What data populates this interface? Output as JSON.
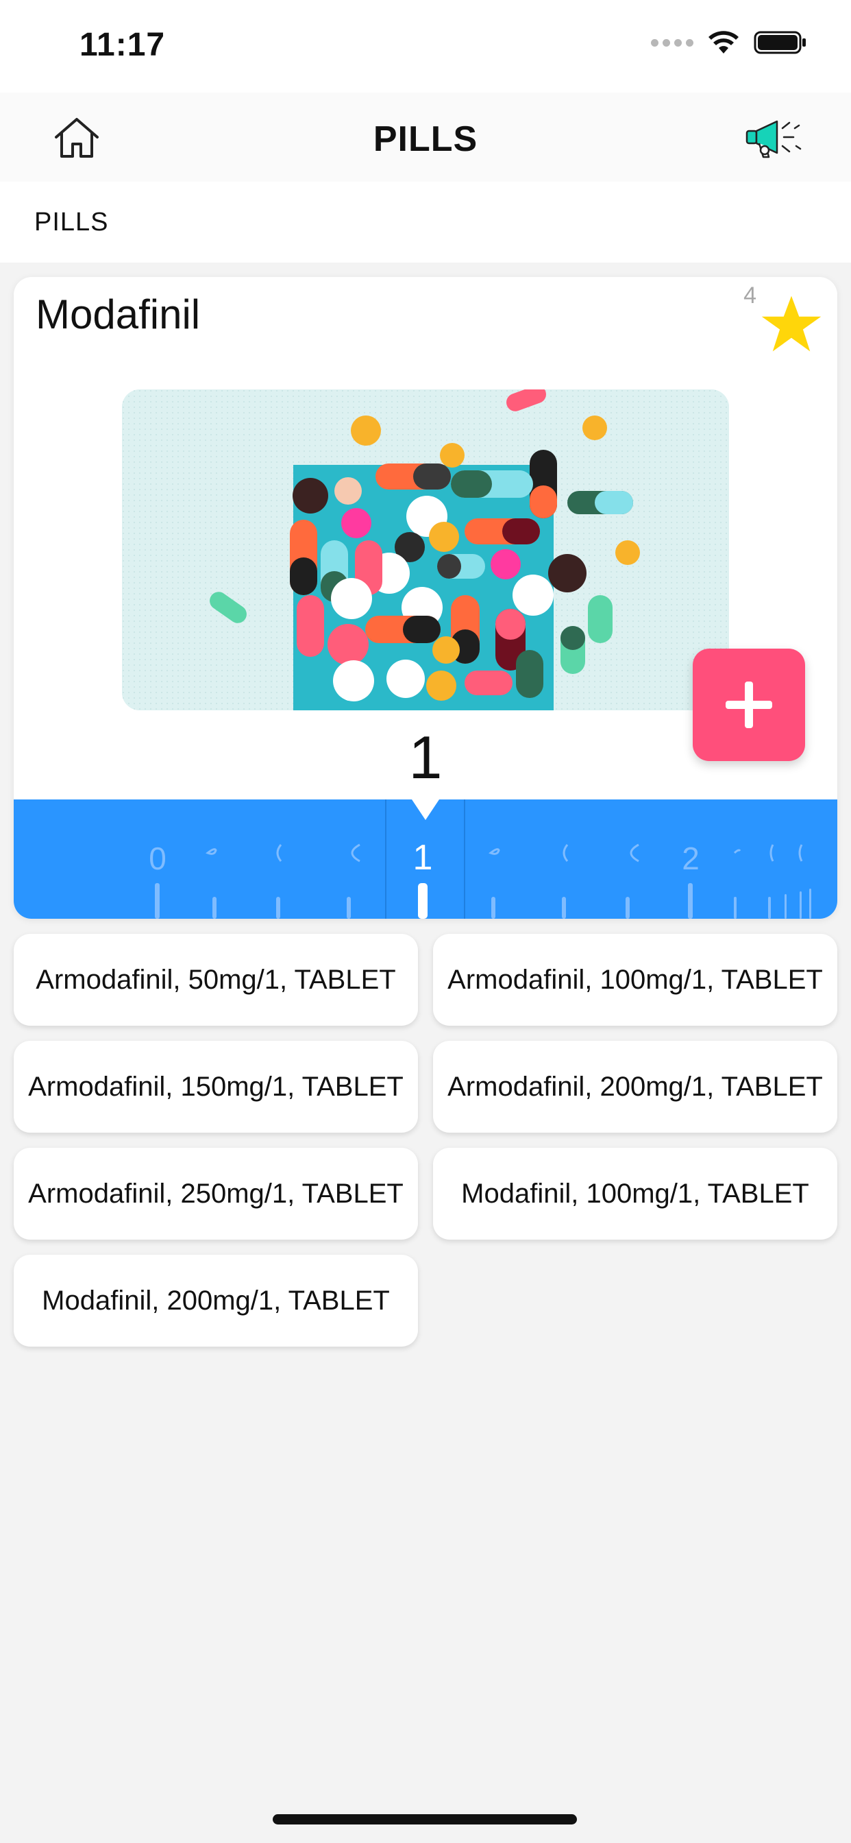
{
  "status_bar": {
    "time": "11:17"
  },
  "nav": {
    "title": "PILLS"
  },
  "section": {
    "title": "PILLS"
  },
  "card": {
    "title": "Modafinil",
    "rating_count": "4",
    "quantity": "1",
    "ruler": {
      "labels": [
        "0",
        "1",
        "2"
      ],
      "selected": "1"
    }
  },
  "variants": [
    "Armodafinil, 50mg/1, TABLET",
    "Armodafinil, 100mg/1, TABLET",
    "Armodafinil, 150mg/1, TABLET",
    "Armodafinil, 200mg/1, TABLET",
    "Armodafinil, 250mg/1, TABLET",
    "Modafinil, 100mg/1, TABLET",
    "Modafinil, 200mg/1, TABLET"
  ],
  "colors": {
    "accent_blue": "#2a95ff",
    "add_button_pink": "#ff4f7b",
    "star_yellow": "#ffd60a",
    "megaphone_teal": "#16d3b8"
  },
  "icons": {
    "home": "home-icon",
    "megaphone": "megaphone-icon",
    "star": "star-icon",
    "add": "plus-icon",
    "wifi": "wifi-icon",
    "battery": "battery-icon"
  }
}
